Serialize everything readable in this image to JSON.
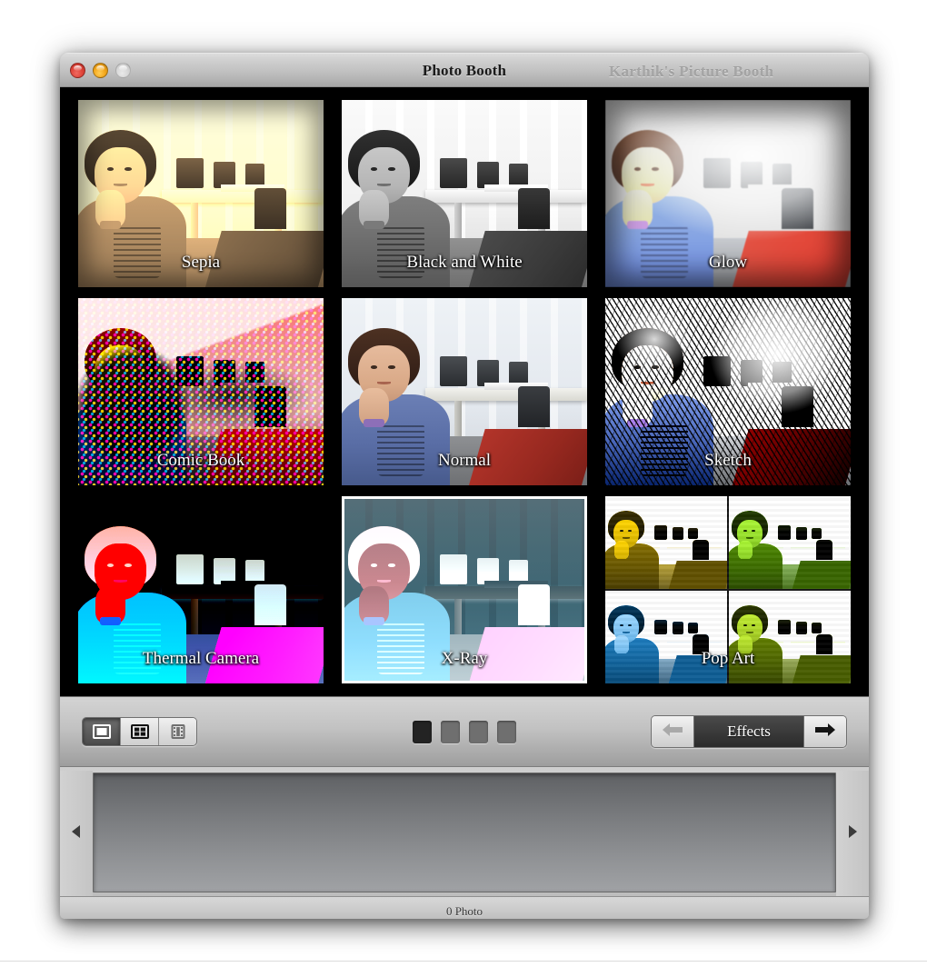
{
  "window": {
    "title": "Photo Booth",
    "watermark": "Karthik's Picture Booth",
    "controls": {
      "close": "close",
      "minimize": "minimize",
      "zoom": "zoom"
    }
  },
  "effects": {
    "tiles": [
      {
        "label": "Sepia",
        "effect": "sepia",
        "selected": false
      },
      {
        "label": "Black and White",
        "effect": "bw",
        "selected": false
      },
      {
        "label": "Glow",
        "effect": "glow",
        "selected": false
      },
      {
        "label": "Comic Book",
        "effect": "comic",
        "selected": false
      },
      {
        "label": "Normal",
        "effect": "normal",
        "selected": true
      },
      {
        "label": "Sketch",
        "effect": "sketch",
        "selected": false
      },
      {
        "label": "Thermal Camera",
        "effect": "thermal",
        "selected": false
      },
      {
        "label": "X-Ray",
        "effect": "xray",
        "selected": false
      },
      {
        "label": "Pop Art",
        "effect": "pop",
        "selected": false
      }
    ]
  },
  "toolbar": {
    "modes": [
      {
        "name": "single-photo",
        "icon": "single-photo-icon",
        "active": true
      },
      {
        "name": "four-up",
        "icon": "four-up-grid-icon",
        "active": false
      },
      {
        "name": "movie",
        "icon": "film-strip-icon",
        "active": false
      }
    ],
    "page_dots": {
      "count": 4,
      "active_index": 0
    },
    "effects_nav": {
      "label": "Effects",
      "prev_enabled": false,
      "next_enabled": true
    }
  },
  "tray": {
    "scroll_left_icon": "triangle-left-icon",
    "scroll_right_icon": "triangle-right-icon",
    "items": []
  },
  "status": {
    "photo_count_text": "0 Photo"
  },
  "colors": {
    "titlebar_top": "#dcdcdc",
    "titlebar_bottom": "#a6a6a6",
    "stage_background": "#000000",
    "effects_label_bg": "#2b2b2b",
    "active_dot": "#232323",
    "inactive_dot": "#6f6f6f"
  }
}
